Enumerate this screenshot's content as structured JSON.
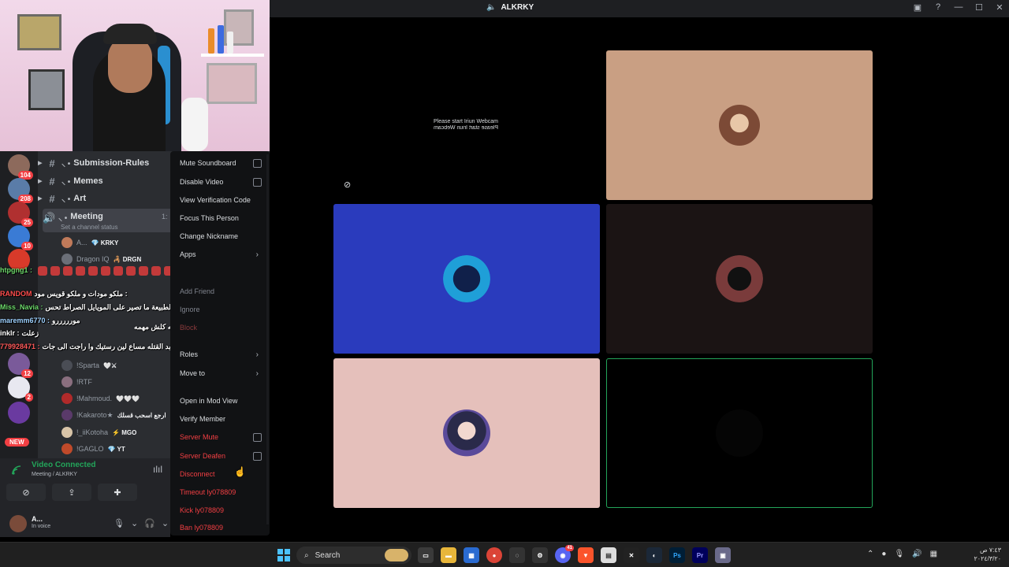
{
  "window": {
    "title": "ALKRKY",
    "controls": [
      "screen-icon",
      "help-icon",
      "minimize-icon",
      "maximize-icon",
      "close-icon"
    ]
  },
  "guild_badges": [
    "104",
    "208",
    "25",
    "10",
    "12",
    "2",
    "NEW"
  ],
  "channels": [
    {
      "name": "Submission-Rules",
      "prefix": "⸜ •"
    },
    {
      "name": "Memes",
      "prefix": "⸜ •"
    },
    {
      "name": "Art",
      "prefix": "⸜ •"
    },
    {
      "name": "Meeting",
      "prefix": "⸜ •",
      "status": "Set a channel status",
      "time": "1:"
    }
  ],
  "voice_members": [
    {
      "name": "A...",
      "tag": "💎 KRKY",
      "color": "#c07a5a"
    },
    {
      "name": "Dragon IQ",
      "tag": "🦂 DRGN",
      "color": "#6b6f78"
    },
    {
      "name": "!Sparta",
      "tag": "🤍⚔",
      "color": "#4a4d55"
    },
    {
      "name": "!RTF",
      "tag": "",
      "color": "#8a6f7f"
    },
    {
      "name": "!Mahmoud.",
      "tag": "🤍🤍🤍",
      "color": "#b02a2a"
    },
    {
      "name": "!Kakaroto★",
      "tag": "ارجع اسحب قسلك",
      "color": "#5a3a6a"
    },
    {
      "name": "!_iiKotoha",
      "tag": "⚡ MGO",
      "color": "#d8c4a8"
    },
    {
      "name": "!GAGLO",
      "tag": "💎 YT",
      "color": "#c04a2a"
    }
  ],
  "chat": [
    {
      "user": "htpgng1 :",
      "msg": ""
    },
    {
      "user": "RANDOM",
      "msg": "ملكو مودات و ملكو قويس مود :"
    },
    {
      "user": "Miss_Navia :",
      "msg": "الموادت الطبيعة ما تصير على المويايل الصراط تحس"
    },
    {
      "user": "maremm6770 :",
      "msg": "مورررررو"
    },
    {
      "user": "",
      "msg": "كركي تعدي سالفه كلش مهمه"
    },
    {
      "user": "inklr :",
      "msg": "زعلت"
    },
    {
      "user": "779928471 :",
      "msg": "باع عبد القتله مساع لين رستيك وا راجت الى جات"
    }
  ],
  "voice_panel": {
    "status": "Video Connected",
    "location": "Meeting / ALKRKY",
    "user_name": "A...",
    "user_status": "In voice"
  },
  "context_menu": [
    {
      "label": "Mute Soundboard",
      "kind": "checkbox"
    },
    {
      "label": "Disable Video",
      "kind": "checkbox"
    },
    {
      "label": "View Verification Code",
      "kind": "item"
    },
    {
      "label": "Focus This Person",
      "kind": "item"
    },
    {
      "label": "Change Nickname",
      "kind": "item"
    },
    {
      "label": "Apps",
      "kind": "submenu"
    },
    {
      "label": "Add Friend",
      "kind": "dim"
    },
    {
      "label": "Ignore",
      "kind": "dim"
    },
    {
      "label": "Block",
      "kind": "dim-danger"
    },
    {
      "label": "Roles",
      "kind": "submenu"
    },
    {
      "label": "Move to",
      "kind": "submenu"
    },
    {
      "label": "Open in Mod View",
      "kind": "item"
    },
    {
      "label": "Verify Member",
      "kind": "item"
    },
    {
      "label": "Server Mute",
      "kind": "danger-checkbox"
    },
    {
      "label": "Server Deafen",
      "kind": "danger-checkbox"
    },
    {
      "label": "Disconnect",
      "kind": "danger"
    },
    {
      "label": "Timeout ly078809",
      "kind": "danger"
    },
    {
      "label": "Kick ly078809",
      "kind": "danger"
    },
    {
      "label": "Ban ly078809",
      "kind": "danger"
    }
  ],
  "stage": {
    "note_line1": "Please start Iriun Webcam",
    "note_line2": "Please start Iriun Webcam",
    "tiles": [
      {
        "bg": "#c99f83",
        "avatar": "#7c4a36"
      },
      {
        "bg": "#2a3bbd",
        "avatar": "#1f9fd8"
      },
      {
        "bg": "#1b1414",
        "avatar": "#7a3b3b"
      },
      {
        "bg": "#e5c0bb",
        "avatar": "#3a2a5a"
      },
      {
        "bg": "#000000",
        "avatar": "#050505"
      }
    ]
  },
  "taskbar": {
    "search_label": "Search",
    "apps": [
      "task-view",
      "file-explorer",
      "store",
      "chrome",
      "app",
      "settings",
      "discord",
      "brave",
      "app",
      "capcut",
      "steam",
      "photoshop",
      "premiere",
      "app"
    ],
    "discord_badge": "41",
    "clock_time": "٧:٤٣ ص",
    "clock_date": "٢٠٢٤/٣/٢٠"
  },
  "colors": {
    "accent_green": "#23a55a",
    "danger_red": "#f23f43",
    "menu_bg": "#111214",
    "sidebar_bg": "#2b2d31"
  }
}
